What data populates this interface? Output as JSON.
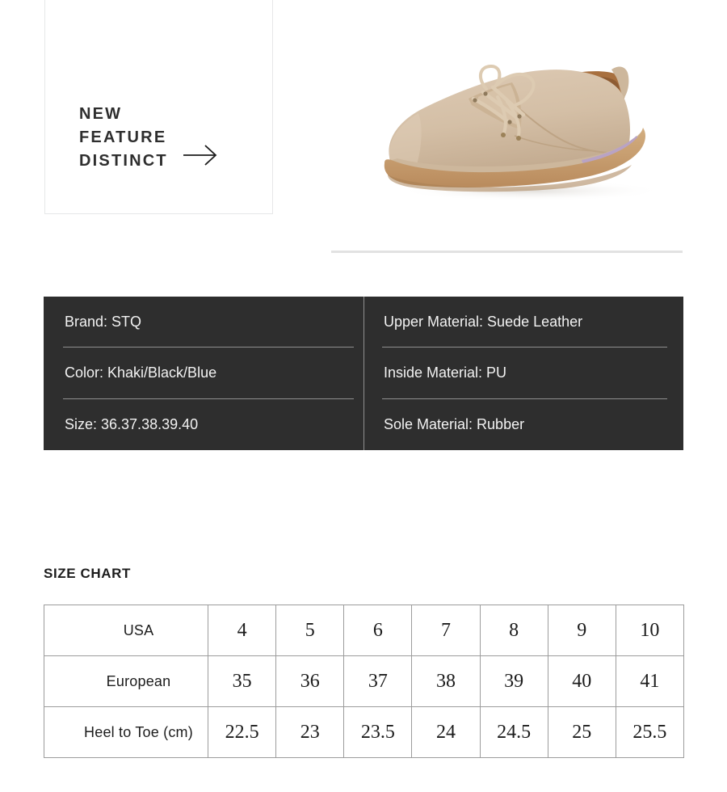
{
  "promo": {
    "title": "NEW\nFEATURE\nDISTINCT",
    "arrow_icon": "arrow-right-icon"
  },
  "product_image": {
    "alt": "khaki suede lace-up oxford shoe",
    "colors": {
      "suede": "#d8c4ad",
      "suede_shadow": "#c5ad93",
      "lining": "#a66a3c",
      "sole_welt": "#cbb79f",
      "sole_purple": "#b9a3c4",
      "outsole": "#c49a6c",
      "lace": "#d9c7b0"
    }
  },
  "specs": {
    "left": [
      "Brand: STQ",
      "Color: Khaki/Black/Blue",
      "Size:  36.37.38.39.40"
    ],
    "right": [
      "Upper  Material:  Suede  Leather",
      "Inside  Material:  PU",
      "Sole  Material:  Rubber"
    ],
    "background": "#2e2e2e",
    "divider_color": "#8f8f8f"
  },
  "size_chart": {
    "heading": "SIZE CHART",
    "rows": [
      {
        "label": "USA",
        "values": [
          "4",
          "5",
          "6",
          "7",
          "8",
          "9",
          "10"
        ]
      },
      {
        "label": "European",
        "values": [
          "35",
          "36",
          "37",
          "38",
          "39",
          "40",
          "41"
        ]
      },
      {
        "label": "Heel to Toe (cm)",
        "values": [
          "22.5",
          "23",
          "23.5",
          "24",
          "24.5",
          "25",
          "25.5"
        ]
      }
    ]
  }
}
